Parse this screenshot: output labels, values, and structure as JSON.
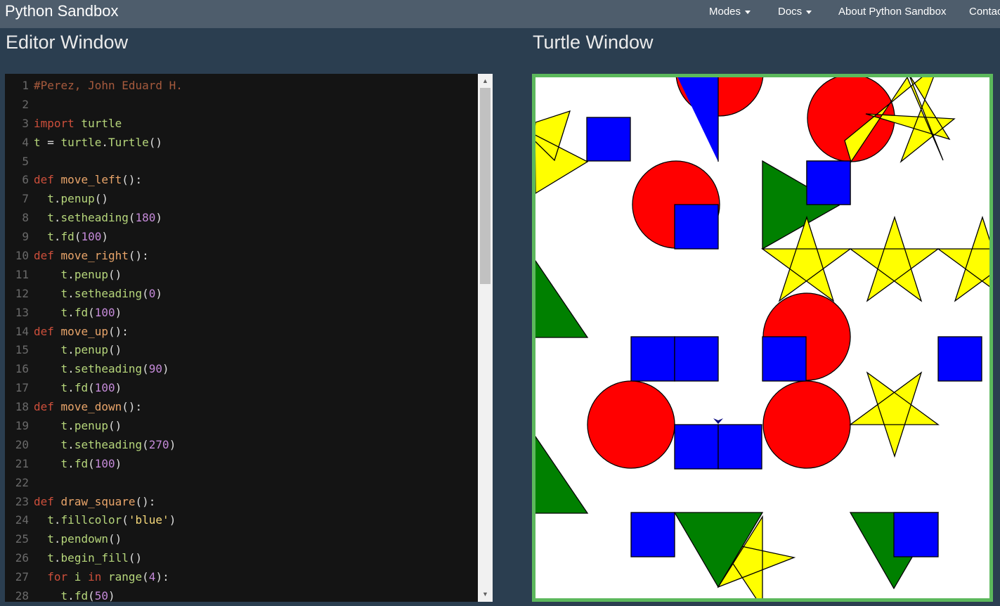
{
  "navbar": {
    "brand": "Python Sandbox",
    "items": [
      {
        "label": "Modes",
        "dropdown": true
      },
      {
        "label": "Docs",
        "dropdown": true
      },
      {
        "label": "About Python Sandbox",
        "dropdown": false
      },
      {
        "label": "Contac",
        "dropdown": false
      }
    ]
  },
  "editor": {
    "title": "Editor Window",
    "lines": [
      {
        "n": "1",
        "tokens": [
          [
            "#Perez, John Eduard H.",
            "comment"
          ]
        ]
      },
      {
        "n": "2",
        "tokens": []
      },
      {
        "n": "3",
        "tokens": [
          [
            "import",
            "kw"
          ],
          [
            " turtle",
            "var"
          ]
        ]
      },
      {
        "n": "4",
        "tokens": [
          [
            "t",
            "var"
          ],
          [
            " = ",
            "punc"
          ],
          [
            "turtle",
            "var"
          ],
          [
            ".",
            "punc"
          ],
          [
            "Turtle",
            "var"
          ],
          [
            "()",
            "punc"
          ]
        ]
      },
      {
        "n": "5",
        "tokens": []
      },
      {
        "n": "6",
        "tokens": [
          [
            "def",
            "kw"
          ],
          [
            " ",
            "punc"
          ],
          [
            "move_left",
            "fn"
          ],
          [
            "():",
            "punc"
          ]
        ]
      },
      {
        "n": "7",
        "tokens": [
          [
            "  t",
            "var"
          ],
          [
            ".",
            "punc"
          ],
          [
            "penup",
            "var"
          ],
          [
            "()",
            "punc"
          ]
        ]
      },
      {
        "n": "8",
        "tokens": [
          [
            "  t",
            "var"
          ],
          [
            ".",
            "punc"
          ],
          [
            "setheading",
            "var"
          ],
          [
            "(",
            "punc"
          ],
          [
            "180",
            "num"
          ],
          [
            ")",
            "punc"
          ]
        ]
      },
      {
        "n": "9",
        "tokens": [
          [
            "  t",
            "var"
          ],
          [
            ".",
            "punc"
          ],
          [
            "fd",
            "var"
          ],
          [
            "(",
            "punc"
          ],
          [
            "100",
            "num"
          ],
          [
            ")",
            "punc"
          ]
        ]
      },
      {
        "n": "10",
        "tokens": [
          [
            "def",
            "kw"
          ],
          [
            " ",
            "punc"
          ],
          [
            "move_right",
            "fn"
          ],
          [
            "():",
            "punc"
          ]
        ]
      },
      {
        "n": "11",
        "tokens": [
          [
            "    t",
            "var"
          ],
          [
            ".",
            "punc"
          ],
          [
            "penup",
            "var"
          ],
          [
            "()",
            "punc"
          ]
        ]
      },
      {
        "n": "12",
        "tokens": [
          [
            "    t",
            "var"
          ],
          [
            ".",
            "punc"
          ],
          [
            "setheading",
            "var"
          ],
          [
            "(",
            "punc"
          ],
          [
            "0",
            "num"
          ],
          [
            ")",
            "punc"
          ]
        ]
      },
      {
        "n": "13",
        "tokens": [
          [
            "    t",
            "var"
          ],
          [
            ".",
            "punc"
          ],
          [
            "fd",
            "var"
          ],
          [
            "(",
            "punc"
          ],
          [
            "100",
            "num"
          ],
          [
            ")",
            "punc"
          ]
        ]
      },
      {
        "n": "14",
        "tokens": [
          [
            "def",
            "kw"
          ],
          [
            " ",
            "punc"
          ],
          [
            "move_up",
            "fn"
          ],
          [
            "():",
            "punc"
          ]
        ]
      },
      {
        "n": "15",
        "tokens": [
          [
            "    t",
            "var"
          ],
          [
            ".",
            "punc"
          ],
          [
            "penup",
            "var"
          ],
          [
            "()",
            "punc"
          ]
        ]
      },
      {
        "n": "16",
        "tokens": [
          [
            "    t",
            "var"
          ],
          [
            ".",
            "punc"
          ],
          [
            "setheading",
            "var"
          ],
          [
            "(",
            "punc"
          ],
          [
            "90",
            "num"
          ],
          [
            ")",
            "punc"
          ]
        ]
      },
      {
        "n": "17",
        "tokens": [
          [
            "    t",
            "var"
          ],
          [
            ".",
            "punc"
          ],
          [
            "fd",
            "var"
          ],
          [
            "(",
            "punc"
          ],
          [
            "100",
            "num"
          ],
          [
            ")",
            "punc"
          ]
        ]
      },
      {
        "n": "18",
        "tokens": [
          [
            "def",
            "kw"
          ],
          [
            " ",
            "punc"
          ],
          [
            "move_down",
            "fn"
          ],
          [
            "():",
            "punc"
          ]
        ]
      },
      {
        "n": "19",
        "tokens": [
          [
            "    t",
            "var"
          ],
          [
            ".",
            "punc"
          ],
          [
            "penup",
            "var"
          ],
          [
            "()",
            "punc"
          ]
        ]
      },
      {
        "n": "20",
        "tokens": [
          [
            "    t",
            "var"
          ],
          [
            ".",
            "punc"
          ],
          [
            "setheading",
            "var"
          ],
          [
            "(",
            "punc"
          ],
          [
            "270",
            "num"
          ],
          [
            ")",
            "punc"
          ]
        ]
      },
      {
        "n": "21",
        "tokens": [
          [
            "    t",
            "var"
          ],
          [
            ".",
            "punc"
          ],
          [
            "fd",
            "var"
          ],
          [
            "(",
            "punc"
          ],
          [
            "100",
            "num"
          ],
          [
            ")",
            "punc"
          ]
        ]
      },
      {
        "n": "22",
        "tokens": []
      },
      {
        "n": "23",
        "tokens": [
          [
            "def",
            "kw"
          ],
          [
            " ",
            "punc"
          ],
          [
            "draw_square",
            "fn"
          ],
          [
            "():",
            "punc"
          ]
        ]
      },
      {
        "n": "24",
        "tokens": [
          [
            "  t",
            "var"
          ],
          [
            ".",
            "punc"
          ],
          [
            "fillcolor",
            "var"
          ],
          [
            "(",
            "punc"
          ],
          [
            "'blue'",
            "str"
          ],
          [
            ")",
            "punc"
          ]
        ]
      },
      {
        "n": "25",
        "tokens": [
          [
            "  t",
            "var"
          ],
          [
            ".",
            "punc"
          ],
          [
            "pendown",
            "var"
          ],
          [
            "()",
            "punc"
          ]
        ]
      },
      {
        "n": "26",
        "tokens": [
          [
            "  t",
            "var"
          ],
          [
            ".",
            "punc"
          ],
          [
            "begin_fill",
            "var"
          ],
          [
            "()",
            "punc"
          ]
        ]
      },
      {
        "n": "27",
        "tokens": [
          [
            "  ",
            "punc"
          ],
          [
            "for",
            "kw"
          ],
          [
            " i ",
            "var"
          ],
          [
            "in",
            "kw"
          ],
          [
            " ",
            "punc"
          ],
          [
            "range",
            "var"
          ],
          [
            "(",
            "punc"
          ],
          [
            "4",
            "num"
          ],
          [
            "):",
            "punc"
          ]
        ]
      },
      {
        "n": "28",
        "tokens": [
          [
            "    t",
            "var"
          ],
          [
            ".",
            "punc"
          ],
          [
            "fd",
            "var"
          ],
          [
            "(",
            "punc"
          ],
          [
            "50",
            "num"
          ],
          [
            ")",
            "punc"
          ]
        ]
      }
    ]
  },
  "turtle": {
    "title": "Turtle Window",
    "colors": {
      "square": "#0000ff",
      "circle": "#ff0000",
      "triangle": "#008000",
      "star": "#ffff00",
      "frame": "#5cb85c"
    }
  }
}
